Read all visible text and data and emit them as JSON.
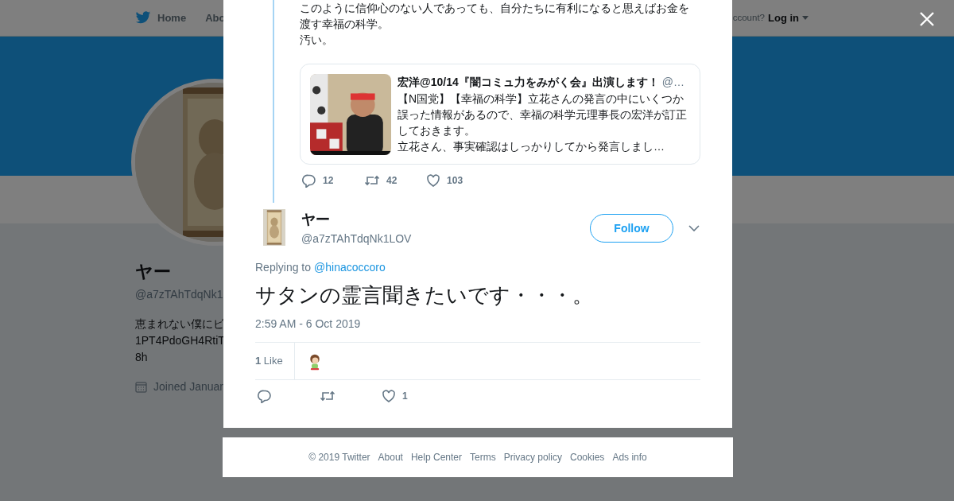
{
  "nav": {
    "items": [
      {
        "label": "Home"
      },
      {
        "label": "Abo"
      }
    ],
    "account_prompt": "ccount?",
    "login": "Log in"
  },
  "profile": {
    "name": "ヤー",
    "handle": "@a7zTAhTdqNk1",
    "bio": [
      "恵まれない僕にビ",
      "1PT4PdoGH4RtiT",
      "8h"
    ],
    "joined": "Joined Januar"
  },
  "parent_tweet": {
    "paragraphs": [
      "このように信仰心のない人であっても、自分たちに有利になると思えばお金を渡す幸福の科学。",
      "汚い。"
    ],
    "quote": {
      "author": "宏洋@10/14『闇コミュ力をみがく会』出演します！",
      "handle": "@…",
      "paragraphs": [
        "【N国党】【幸福の科学】立花さんの発言の中にいくつか誤った情報があるので、幸福の科学元理事長の宏洋が訂正しておきます。",
        "立花さん、事実確認はしっかりしてから発言しまし…"
      ]
    },
    "actions": [
      {
        "kind": "reply",
        "count": "12"
      },
      {
        "kind": "retweet",
        "count": "42"
      },
      {
        "kind": "like",
        "count": "103"
      }
    ]
  },
  "tweet": {
    "name": "ヤー",
    "handle": "@a7zTAhTdqNk1LOV",
    "follow": "Follow",
    "replying_label": "Replying to",
    "replying_to": "@hinacoccoro",
    "text": "サタンの霊言聞きたいです・・・。",
    "time": "2:59 AM - 6 Oct 2019",
    "likes": "**1** Like",
    "actions": [
      {
        "kind": "reply"
      },
      {
        "kind": "retweet"
      },
      {
        "kind": "like",
        "count": "1"
      }
    ]
  },
  "footer": [
    "© 2019 Twitter",
    "About",
    "Help Center",
    "Terms",
    "Privacy policy",
    "Cookies",
    "Ads info"
  ]
}
